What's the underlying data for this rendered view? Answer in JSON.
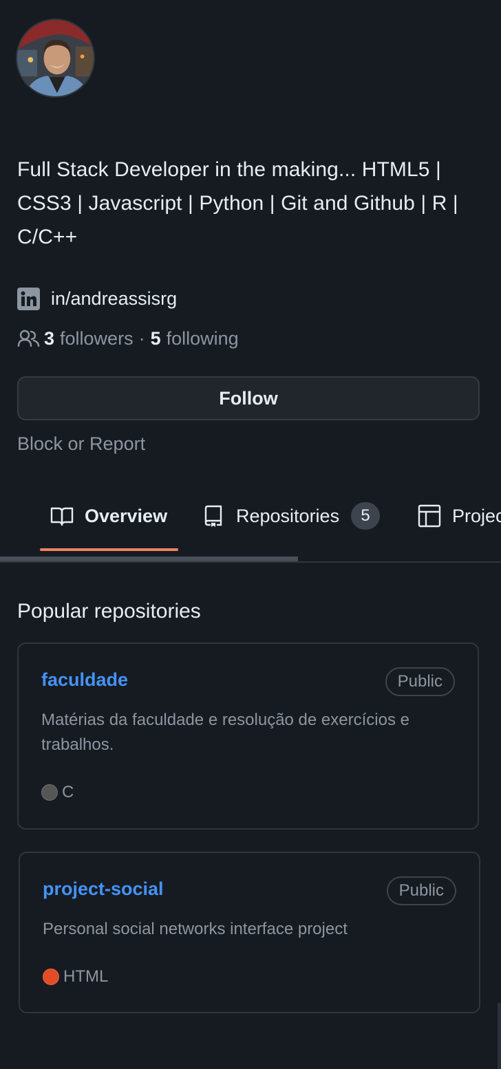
{
  "profile": {
    "bio": "Full Stack Developer in the making... HTML5 | CSS3 | Javascript | Python | Git and Github | R | C/C++",
    "linkedin": "in/andreassisrg",
    "followers_count": "3",
    "followers_label": "followers",
    "separator": "·",
    "following_count": "5",
    "following_label": "following",
    "follow_button": "Follow",
    "block_report": "Block or Report"
  },
  "tabs": [
    {
      "label": "Overview",
      "icon": "book-icon",
      "selected": true
    },
    {
      "label": "Repositories",
      "icon": "repo-icon",
      "counter": "5"
    },
    {
      "label": "Projects",
      "visible_text": "Projec",
      "icon": "table-icon"
    }
  ],
  "popular": {
    "title": "Popular repositories",
    "repos": [
      {
        "name": "faculdade",
        "visibility": "Public",
        "description": "Matérias da faculdade e resolução de exercícios e trabalhos.",
        "language": "C",
        "language_color": "#555555"
      },
      {
        "name": "project-social",
        "visibility": "Public",
        "description": "Personal social networks interface project",
        "language": "HTML",
        "language_color": "#e34c26"
      }
    ]
  },
  "colors": {
    "background": "#161b22",
    "link": "#4493f8",
    "tab_underline": "#f78166",
    "muted_text": "#8d96a0"
  }
}
